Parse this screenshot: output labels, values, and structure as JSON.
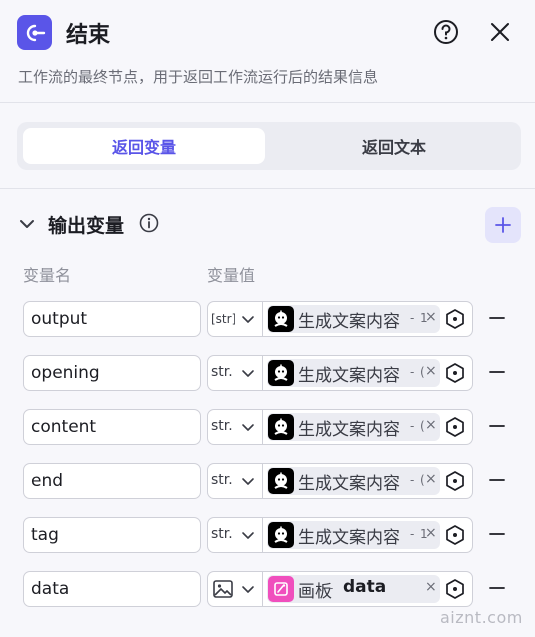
{
  "header": {
    "title": "结束",
    "description": "工作流的最终节点，用于返回工作流运行后的结果信息",
    "icon": "end-node-icon",
    "help_icon": "help-circle-icon",
    "close_icon": "close-icon",
    "accent_color": "#5a55e8"
  },
  "tabs": [
    {
      "label": "返回变量",
      "active": true
    },
    {
      "label": "返回文本",
      "active": false
    }
  ],
  "section": {
    "title": "输出变量",
    "info_icon": "info-icon",
    "add_icon": "plus-icon"
  },
  "columns": {
    "name": "变量名",
    "value": "变量值"
  },
  "rows": [
    {
      "name": "output",
      "type": "[str]",
      "ref_node": "生成文案内容",
      "ref_sep": "- ",
      "ref_field_visible": "1",
      "avatar": "robot-avatar-icon"
    },
    {
      "name": "opening",
      "type": "str.",
      "ref_node": "生成文案内容",
      "ref_sep": "- ",
      "ref_field_visible": "(",
      "avatar": "robot-avatar-icon"
    },
    {
      "name": "content",
      "type": "str.",
      "ref_node": "生成文案内容",
      "ref_sep": "- ",
      "ref_field_visible": "(",
      "avatar": "robot-avatar-icon"
    },
    {
      "name": "end",
      "type": "str.",
      "ref_node": "生成文案内容",
      "ref_sep": "- ",
      "ref_field_visible": "(",
      "avatar": "robot-avatar-icon"
    },
    {
      "name": "tag",
      "type": "str.",
      "ref_node": "生成文案内容",
      "ref_sep": "- ",
      "ref_field_visible": "1",
      "avatar": "robot-avatar-icon"
    },
    {
      "name": "data",
      "type": "image",
      "ref_node": "画板",
      "ref_sep": "- ",
      "ref_field_visible": "data",
      "avatar": "board-icon"
    }
  ],
  "clear_symbol": "×",
  "watermark": "aiznt.com"
}
